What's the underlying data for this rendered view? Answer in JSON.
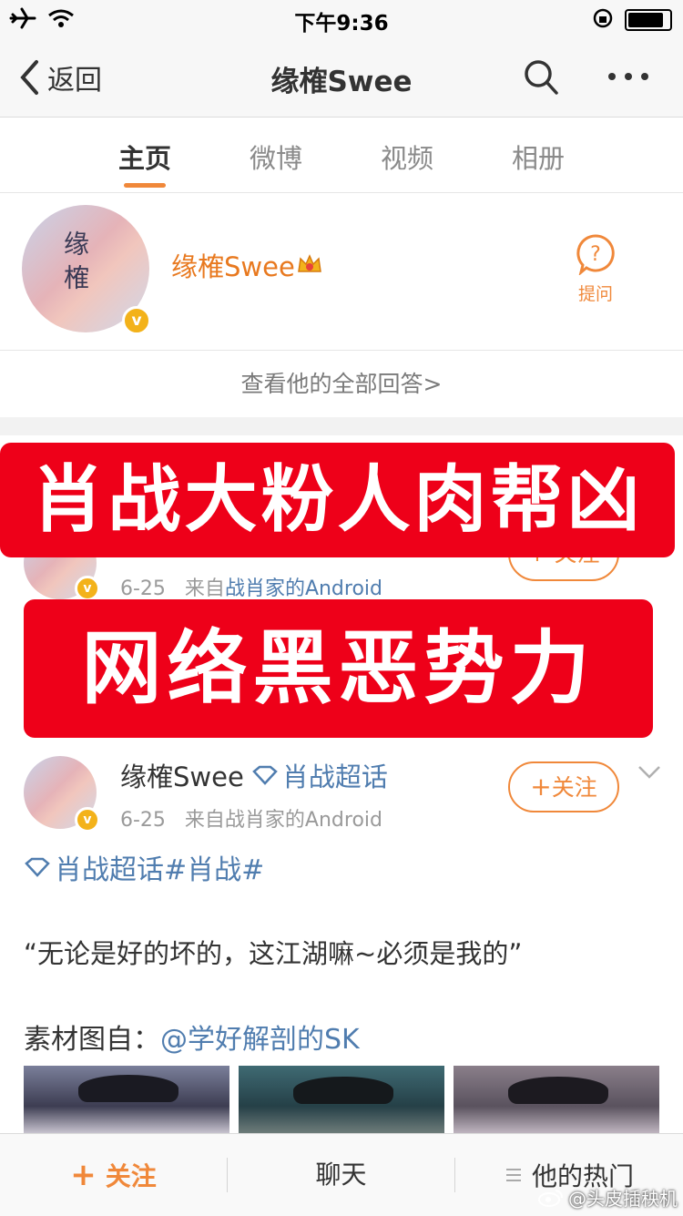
{
  "status": {
    "time": "下午9:36"
  },
  "nav": {
    "back_label": "返回",
    "title": "缘榷Swee"
  },
  "tabs": [
    {
      "label": "主页",
      "active": true
    },
    {
      "label": "微博",
      "active": false
    },
    {
      "label": "视频",
      "active": false
    },
    {
      "label": "相册",
      "active": false
    }
  ],
  "profile": {
    "avatar_glyphs": "缘 榷",
    "name": "缘榷Swee",
    "ask_label": "提问"
  },
  "all_answers": "查看他的全部回答>",
  "banners": {
    "top": "肖战大粉人肉帮凶",
    "bottom": "网络黑恶势力"
  },
  "post1": {
    "meta_date": "6-25",
    "meta_from": "来自",
    "meta_source": "战肖家的Android",
    "follow_label": "+ 关注"
  },
  "post2": {
    "username": "缘榷Swee",
    "topic": "肖战超话",
    "date": "6-25",
    "source_text": "来自战肖家的Android",
    "follow_label": "关注",
    "tag_line": "肖战超话#肖战#",
    "quote": "“无论是好的坏的，这江湖嘛~必须是我的”",
    "credit_label": "素材图自：",
    "credit_user": "@学好解剖的SK"
  },
  "bottom": {
    "follow_label": "关注",
    "chat_label": "聊天",
    "hot_label": "他的热门"
  },
  "watermark": "@头皮插秧机",
  "colors": {
    "accent": "#f0883a",
    "link": "#507daf",
    "banner": "#ee0019",
    "badge": "#f3b21a"
  }
}
